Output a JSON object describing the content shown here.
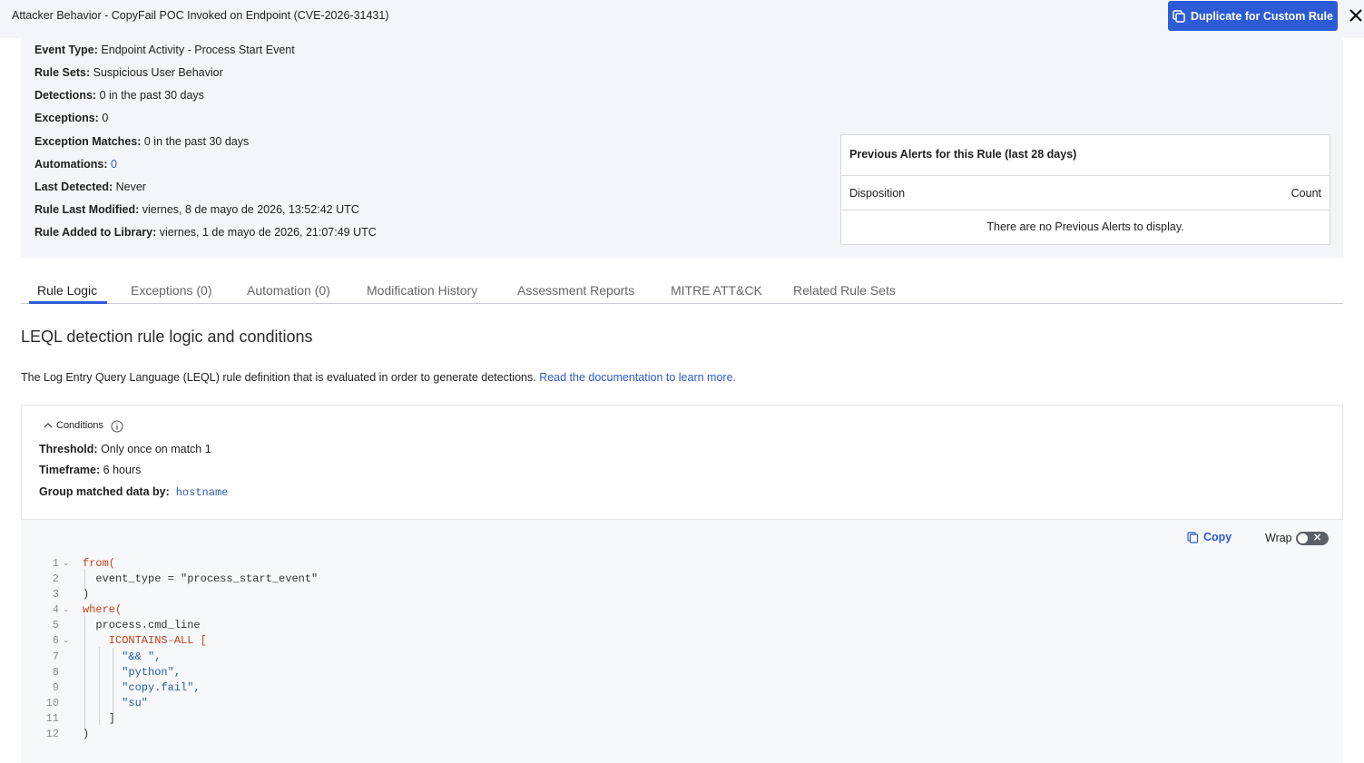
{
  "header": {
    "title": "Attacker Behavior - CopyFail POC Invoked on Endpoint (CVE-2026-31431)",
    "duplicate_label": "Duplicate for Custom Rule"
  },
  "summary": {
    "event_type_label": "Event Type:",
    "event_type": "Endpoint Activity - Process Start Event",
    "rule_sets_label": "Rule Sets:",
    "rule_sets": "Suspicious User Behavior",
    "detections_label": "Detections:",
    "detections": "0 in the past 30 days",
    "exceptions_label": "Exceptions:",
    "exceptions": "0",
    "exception_matches_label": "Exception Matches:",
    "exception_matches": "0 in the past 30 days",
    "automations_label": "Automations:",
    "automations": "0",
    "last_detected_label": "Last Detected:",
    "last_detected": "Never",
    "rule_last_modified_label": "Rule Last Modified:",
    "rule_last_modified": "viernes, 8 de mayo de 2026, 13:52:42 UTC",
    "rule_added_label": "Rule Added to Library:",
    "rule_added": "viernes, 1 de mayo de 2026, 21:07:49 UTC"
  },
  "alerts": {
    "title": "Previous Alerts for this Rule (last 28 days)",
    "col_disposition": "Disposition",
    "col_count": "Count",
    "empty": "There are no Previous Alerts to display."
  },
  "tabs": [
    "Rule Logic",
    "Exceptions (0)",
    "Automation (0)",
    "Modification History",
    "Assessment Reports",
    "MITRE ATT&CK",
    "Related Rule Sets"
  ],
  "main": {
    "heading": "LEQL detection rule logic and conditions",
    "description": "The Log Entry Query Language (LEQL) rule definition that is evaluated in order to generate detections.",
    "doc_link": "Read the documentation to learn more."
  },
  "conditions": {
    "toggle_label": "Conditions",
    "threshold_label": "Threshold:",
    "threshold": "Only once on match 1",
    "timeframe_label": "Timeframe:",
    "timeframe": "6 hours",
    "group_label": "Group matched data by:",
    "group": "hostname"
  },
  "code": {
    "copy_label": "Copy",
    "wrap_label": "Wrap",
    "line_numbers": [
      "1",
      "2",
      "3",
      "4",
      "5",
      "6",
      "7",
      "8",
      "9",
      "10",
      "11",
      "12"
    ],
    "lines": [
      "from(",
      "  event_type = \"process_start_event\"",
      ")",
      "where(",
      "  process.cmd_line",
      "    ICONTAINS-ALL [",
      "      \"&& \",",
      "      \"python\",",
      "      \"copy.fail\",",
      "      \"su\"",
      "    ]",
      ")"
    ]
  }
}
